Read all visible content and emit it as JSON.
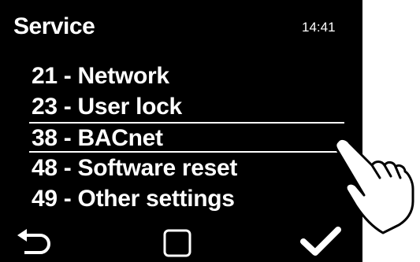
{
  "header": {
    "title": "Service",
    "time": "14:41"
  },
  "menu": {
    "items": [
      {
        "label": "21 - Network"
      },
      {
        "label": "23 - User lock"
      },
      {
        "label": "38 - BACnet",
        "selected": true
      },
      {
        "label": "48 - Software reset"
      },
      {
        "label": "49 - Other settings"
      }
    ]
  },
  "footer": {
    "back_icon": "back-arrow-icon",
    "home_icon": "square-icon",
    "confirm_icon": "checkmark-icon"
  },
  "overlay": {
    "icon": "pointing-hand-icon"
  },
  "colors": {
    "screen_bg": "#000000",
    "text": "#ffffff",
    "page_bg": "#ffffff"
  }
}
